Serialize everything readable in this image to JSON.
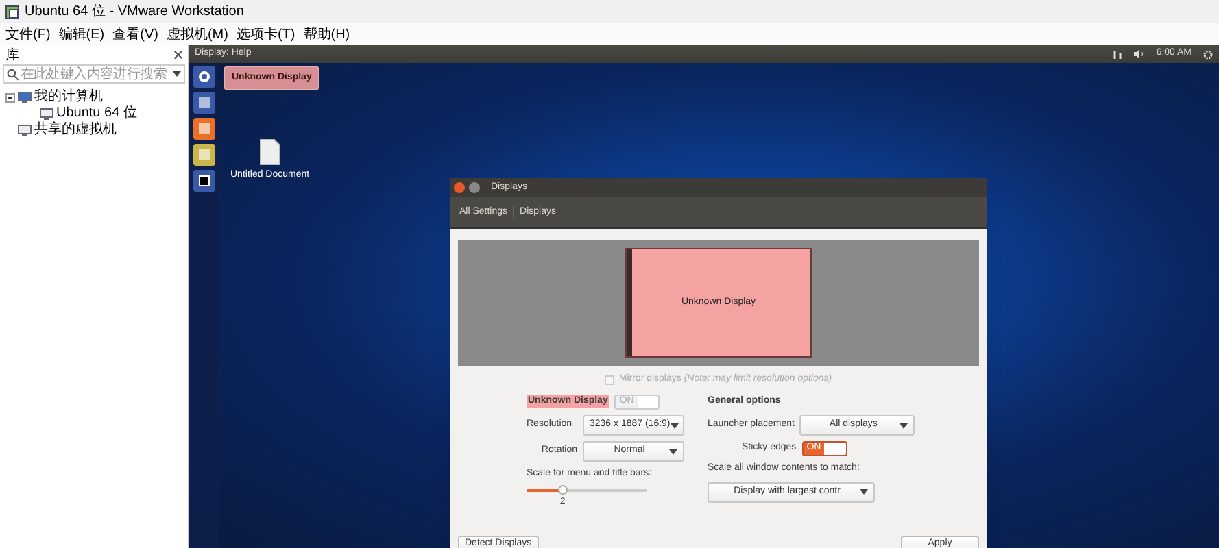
{
  "window": {
    "title": "Ubuntu 64 位 - VMware Workstation"
  },
  "menu_bar": [
    "文件(F)",
    "编辑(E)",
    "查看(V)",
    "虚拟机(M)",
    "选项卡(T)",
    "帮助(H)"
  ],
  "library": {
    "title": "库",
    "search": {
      "placeholder": "在此处键入内容进行搜索"
    },
    "tree": [
      {
        "label": "我的计算机",
        "expanded": true,
        "children": [
          {
            "label": "Ubuntu 64 位"
          }
        ]
      },
      {
        "label": "共享的虚拟机"
      }
    ]
  },
  "guest": {
    "top_bar": {
      "menu": "Display: Help",
      "clock": "6:00 AM"
    },
    "launcher_tooltip": "Unknown Display",
    "desktop_icon": "Untitled Document",
    "displays_window": {
      "title": "Displays",
      "breadcrumb": [
        "All Settings",
        "Displays"
      ],
      "preview_label": "Unknown Display",
      "mirror": {
        "label": "Mirror displays",
        "note": "(Note: may limit resolution options)",
        "checked": false
      },
      "display_name": "Unknown Display",
      "display_switch": {
        "label": "ON",
        "on": false
      },
      "resolution": {
        "label": "Resolution",
        "value": "3236 x 1887 (16:9)"
      },
      "rotation": {
        "label": "Rotation",
        "value": "Normal"
      },
      "scale": {
        "label": "Scale for menu and title bars:",
        "level": 0.3,
        "reading": "2"
      },
      "general": {
        "heading": "General options",
        "launcher": {
          "label": "Launcher placement",
          "value": "All displays"
        },
        "sticky": {
          "label": "Sticky edges",
          "switch_label": "ON",
          "on": true
        },
        "scale_all": {
          "label": "Scale all window contents to match:",
          "value": "Display with largest contr"
        }
      },
      "buttons": [
        "Detect Displays",
        "Apply"
      ]
    }
  }
}
